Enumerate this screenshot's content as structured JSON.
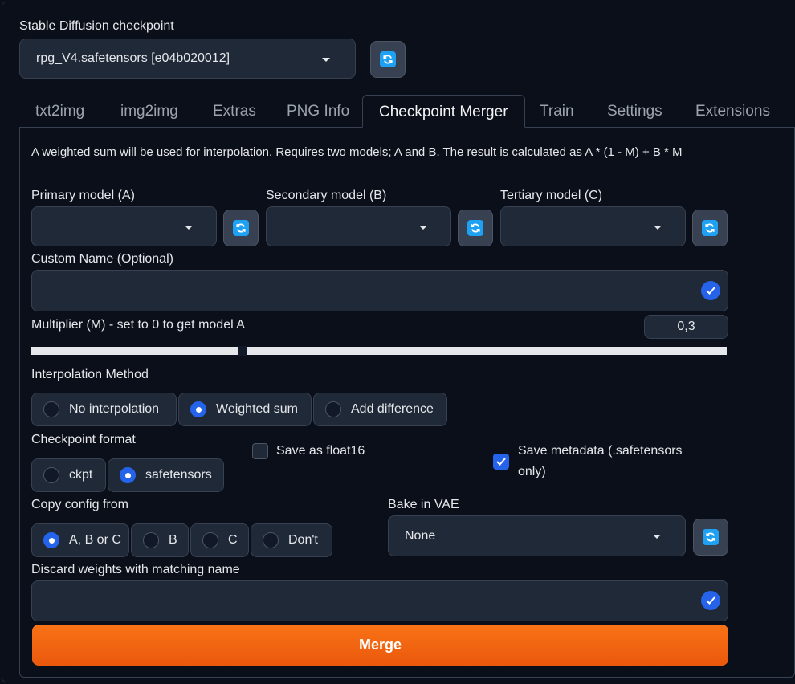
{
  "checkpoint": {
    "label": "Stable Diffusion checkpoint",
    "value": "rpg_V4.safetensors [e04b020012]"
  },
  "tabs": [
    {
      "label": "txt2img",
      "active": false
    },
    {
      "label": "img2img",
      "active": false
    },
    {
      "label": "Extras",
      "active": false
    },
    {
      "label": "PNG Info",
      "active": false
    },
    {
      "label": "Checkpoint Merger",
      "active": true
    },
    {
      "label": "Train",
      "active": false
    },
    {
      "label": "Settings",
      "active": false
    },
    {
      "label": "Extensions",
      "active": false
    }
  ],
  "merger": {
    "description": "A weighted sum will be used for interpolation. Requires two models; A and B. The result is calculated as A * (1 - M) + B * M",
    "primary_label": "Primary model (A)",
    "secondary_label": "Secondary model (B)",
    "tertiary_label": "Tertiary model (C)",
    "primary_value": "",
    "secondary_value": "",
    "tertiary_value": "",
    "custom_name_label": "Custom Name (Optional)",
    "custom_name_value": "",
    "multiplier_label": "Multiplier (M) - set to 0 to get model A",
    "multiplier_value": "0,3",
    "multiplier_fraction": 0.3,
    "interp_label": "Interpolation Method",
    "interp_options": [
      "No interpolation",
      "Weighted sum",
      "Add difference"
    ],
    "interp_selected": 1,
    "format_label": "Checkpoint format",
    "format_options": [
      "ckpt",
      "safetensors"
    ],
    "format_selected": 1,
    "float16_label": "Save as float16",
    "float16_checked": false,
    "metadata_label_1": "Save metadata (.safetensors",
    "metadata_label_2": "only)",
    "metadata_checked": true,
    "config_label": "Copy config from",
    "config_options": [
      "A, B or C",
      "B",
      "C",
      "Don't"
    ],
    "config_selected": 0,
    "vae_label": "Bake in VAE",
    "vae_value": "None",
    "discard_label": "Discard weights with matching name",
    "discard_value": "",
    "merge_label": "Merge"
  },
  "colors": {
    "background": "#0b0f19",
    "panel": "#1f2937",
    "accent": "#2563eb",
    "refresh": "#1ea1f2",
    "merge_start": "#f97316",
    "merge_end": "#ea580c"
  }
}
